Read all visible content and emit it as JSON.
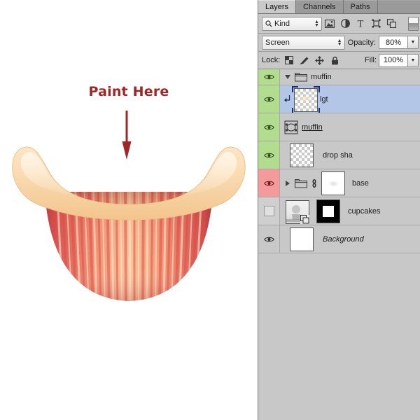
{
  "canvas": {
    "annotation_text": "Paint Here",
    "annotation_color": "#a02626",
    "arrow_direction": "down",
    "artwork": "cupcake-wrapper-with-muffin-top",
    "background_color": "#ffffff"
  },
  "panel": {
    "tabs": [
      {
        "label": "Layers",
        "active": true
      },
      {
        "label": "Channels",
        "active": false
      },
      {
        "label": "Paths",
        "active": false
      }
    ],
    "filter": {
      "kind_label": "Kind",
      "icons": [
        "search-icon",
        "pixel-layer-filter-icon",
        "adjustment-layer-filter-icon",
        "type-layer-filter-icon",
        "shape-layer-filter-icon",
        "smart-object-filter-icon",
        "filter-toggle-switch"
      ]
    },
    "blend": {
      "mode": "Screen",
      "opacity_label": "Opacity:",
      "opacity_value": "80%"
    },
    "lock": {
      "label": "Lock:",
      "icons": [
        "lock-transparent-pixels-icon",
        "lock-image-pixels-icon",
        "lock-position-icon",
        "lock-all-icon"
      ],
      "fill_label": "Fill:",
      "fill_value": "100%"
    },
    "layers": [
      {
        "name": "muffin",
        "type": "group",
        "visible": true,
        "expanded": true,
        "selected": false,
        "eye_state": "green",
        "thumb": "folder",
        "clipped": false,
        "italic": false,
        "underline": false
      },
      {
        "name": "lgt",
        "type": "pixel",
        "visible": true,
        "expanded": false,
        "selected": true,
        "eye_state": "green",
        "thumb": "transparent-soft-highlight",
        "clipped": true,
        "italic": false,
        "underline": false
      },
      {
        "name": "muffin",
        "type": "shape",
        "visible": true,
        "expanded": false,
        "selected": false,
        "eye_state": "green",
        "thumb": "vector-shape-icon",
        "clipped": false,
        "italic": false,
        "underline": true
      },
      {
        "name": "drop sha",
        "type": "pixel",
        "visible": true,
        "expanded": false,
        "selected": false,
        "eye_state": "green",
        "thumb": "transparent",
        "clipped": false,
        "italic": false,
        "underline": false
      },
      {
        "name": "base",
        "type": "group",
        "visible": true,
        "expanded": false,
        "selected": false,
        "eye_state": "red",
        "thumb": "folder-with-linked-mask",
        "clipped": false,
        "italic": false,
        "underline": false
      },
      {
        "name": "cupcakes",
        "type": "smart-object",
        "visible": false,
        "expanded": false,
        "selected": false,
        "eye_state": "off",
        "thumb": "photo-with-smartobject-badge-and-black-mask",
        "clipped": false,
        "italic": false,
        "underline": false
      },
      {
        "name": "Background",
        "type": "background",
        "visible": true,
        "expanded": false,
        "selected": false,
        "eye_state": "plain",
        "thumb": "white",
        "clipped": false,
        "italic": true,
        "underline": false
      }
    ],
    "colors": {
      "panel_bg": "#c8c8c8",
      "selected_row": "#b4c6e8",
      "eye_visible": "#b3dd8e",
      "eye_locked": "#f49a9a",
      "tab_active": "#c9c9c9"
    }
  }
}
